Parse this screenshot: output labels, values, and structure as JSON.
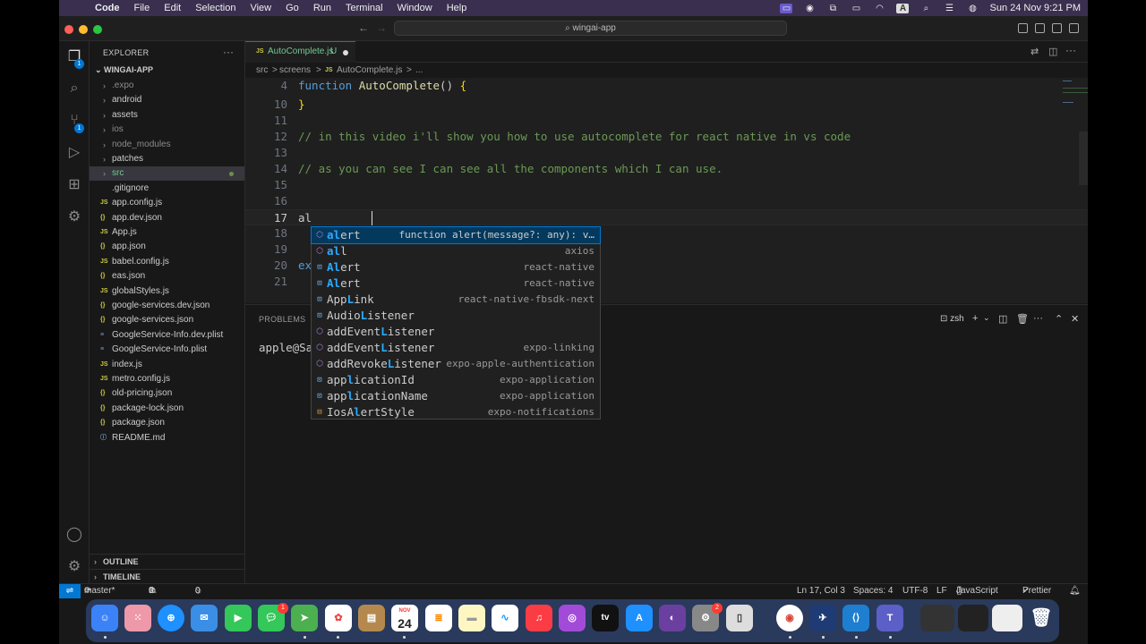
{
  "menubar": {
    "apple": "",
    "items": [
      "Code",
      "File",
      "Edit",
      "Selection",
      "View",
      "Go",
      "Run",
      "Terminal",
      "Window",
      "Help"
    ],
    "clock": "Sun 24 Nov  9:21 PM",
    "input_source": "A"
  },
  "titlebar": {
    "search": "wingai-app"
  },
  "activity": {
    "explorer_badge": "1",
    "scm_badge": "1"
  },
  "sidebar": {
    "header": "EXPLORER",
    "more": "···",
    "root": "WINGAI-APP",
    "items": [
      {
        "label": ".expo",
        "kind": "folder",
        "color": "#8b8b8b"
      },
      {
        "label": "android",
        "kind": "folder",
        "color": "#cccccc"
      },
      {
        "label": "assets",
        "kind": "folder",
        "color": "#cccccc"
      },
      {
        "label": "ios",
        "kind": "folder",
        "color": "#8b8b8b"
      },
      {
        "label": "node_modules",
        "kind": "folder",
        "color": "#8b8b8b"
      },
      {
        "label": "patches",
        "kind": "folder",
        "color": "#cccccc"
      },
      {
        "label": "src",
        "kind": "folder",
        "color": "#73c991"
      },
      {
        "label": ".gitignore",
        "kind": "file",
        "icon": "",
        "color": "#cccccc"
      },
      {
        "label": "app.config.js",
        "kind": "file",
        "icon": "JS",
        "color": "#cccccc"
      },
      {
        "label": "app.dev.json",
        "kind": "file",
        "icon": "{}",
        "color": "#cccccc"
      },
      {
        "label": "App.js",
        "kind": "file",
        "icon": "JS",
        "color": "#cccccc"
      },
      {
        "label": "app.json",
        "kind": "file",
        "icon": "{}",
        "color": "#cccccc"
      },
      {
        "label": "babel.config.js",
        "kind": "file",
        "icon": "JS",
        "color": "#cccccc"
      },
      {
        "label": "eas.json",
        "kind": "file",
        "icon": "{}",
        "color": "#cccccc"
      },
      {
        "label": "globalStyles.js",
        "kind": "file",
        "icon": "JS",
        "color": "#cccccc"
      },
      {
        "label": "google-services.dev.json",
        "kind": "file",
        "icon": "{}",
        "color": "#cccccc"
      },
      {
        "label": "google-services.json",
        "kind": "file",
        "icon": "{}",
        "color": "#cccccc"
      },
      {
        "label": "GoogleService-Info.dev.plist",
        "kind": "file",
        "icon": "≡",
        "color": "#cccccc"
      },
      {
        "label": "GoogleService-Info.plist",
        "kind": "file",
        "icon": "≡",
        "color": "#cccccc"
      },
      {
        "label": "index.js",
        "kind": "file",
        "icon": "JS",
        "color": "#cccccc"
      },
      {
        "label": "metro.config.js",
        "kind": "file",
        "icon": "JS",
        "color": "#cccccc"
      },
      {
        "label": "old-pricing.json",
        "kind": "file",
        "icon": "{}",
        "color": "#cccccc"
      },
      {
        "label": "package-lock.json",
        "kind": "file",
        "icon": "{}",
        "color": "#cccccc"
      },
      {
        "label": "package.json",
        "kind": "file",
        "icon": "{}",
        "color": "#cccccc"
      },
      {
        "label": "README.md",
        "kind": "file",
        "icon": "ⓘ",
        "color": "#cccccc"
      }
    ],
    "outline": "OUTLINE",
    "timeline": "TIMELINE"
  },
  "editor": {
    "tab": {
      "icon": "JS",
      "name": "AutoComplete.js",
      "status": "U"
    },
    "breadcrumb": [
      "src",
      ">",
      "screens",
      ">",
      "JS",
      "AutoComplete.js",
      ">",
      "..."
    ],
    "lines": [
      {
        "num": "4",
        "parts": [
          [
            "kw",
            "function "
          ],
          [
            "fn",
            "AutoComplete"
          ],
          [
            "id",
            "() "
          ],
          [
            "br",
            "{"
          ]
        ]
      },
      {
        "num": "10",
        "parts": [
          [
            "br",
            "}"
          ]
        ]
      },
      {
        "num": "11",
        "parts": []
      },
      {
        "num": "12",
        "parts": [
          [
            "cm",
            "// in this video i'll show you how to use autocomplete for react native in vs code"
          ]
        ]
      },
      {
        "num": "13",
        "parts": []
      },
      {
        "num": "14",
        "parts": [
          [
            "cm",
            "// as you can see I can see all the components which I can use."
          ]
        ]
      },
      {
        "num": "15",
        "parts": []
      },
      {
        "num": "16",
        "parts": []
      },
      {
        "num": "17",
        "parts": [
          [
            "id",
            "al"
          ]
        ]
      },
      {
        "num": "18",
        "parts": []
      },
      {
        "num": "19",
        "parts": []
      },
      {
        "num": "20",
        "parts": [
          [
            "kw",
            "ex"
          ]
        ]
      },
      {
        "num": "21",
        "parts": []
      }
    ],
    "current_line": "17"
  },
  "suggest": {
    "items": [
      {
        "icon": "fn",
        "pre": "",
        "match": "al",
        "post": "ert",
        "detail": "function alert(message?: any): v…"
      },
      {
        "icon": "fn",
        "pre": "",
        "match": "al",
        "post": "l",
        "detail": "axios"
      },
      {
        "icon": "var",
        "pre": "",
        "match": "Al",
        "post": "ert",
        "detail": "react-native"
      },
      {
        "icon": "var",
        "pre": "",
        "match": "Al",
        "post": "ert",
        "detail": "react-native"
      },
      {
        "icon": "var",
        "pre": "",
        "match": "A",
        "post": "ppLink",
        "detail": "react-native-fbsdk-next",
        "mid": {
          "pre": "App",
          "match": "L",
          "post": "ink"
        }
      },
      {
        "icon": "var",
        "pre": "",
        "match": "",
        "post": "",
        "full": {
          "pre": "Audio",
          "match": "L",
          "post": "istener",
          "first": "A"
        },
        "detail": ""
      },
      {
        "icon": "fn",
        "full": {
          "pre": "addEvent",
          "match": "L",
          "post": "istener",
          "first": "a"
        },
        "detail": ""
      },
      {
        "icon": "fn",
        "full": {
          "pre": "addEvent",
          "match": "L",
          "post": "istener",
          "first": "a"
        },
        "detail": "expo-linking"
      },
      {
        "icon": "fn",
        "full": {
          "pre": "addRevoke",
          "match": "L",
          "post": "istener",
          "first": "a"
        },
        "detail": "expo-apple-authentication"
      },
      {
        "icon": "var",
        "full": {
          "pre": "app",
          "match": "l",
          "post": "icationId",
          "first": "a"
        },
        "detail": "expo-application"
      },
      {
        "icon": "var",
        "full": {
          "pre": "app",
          "match": "l",
          "post": "icationName",
          "first": "a"
        },
        "detail": "expo-application"
      },
      {
        "icon": "enum",
        "full": {
          "pre": "IosA",
          "match": "l",
          "post": "ertStyle",
          "first": ""
        },
        "detail": "expo-notifications"
      }
    ]
  },
  "panel": {
    "tab": "PROBLEMS",
    "terminal_text": "apple@Sa",
    "shell": "zsh"
  },
  "statusbar": {
    "branch": "master*",
    "errors": "0",
    "warnings": "0",
    "ports": "0",
    "position": "Ln 17, Col 3",
    "spaces": "Spaces: 4",
    "encoding": "UTF-8",
    "eol": "LF",
    "language": "JavaScript",
    "formatter": "Prettier"
  },
  "dock": {
    "calendar_month": "NOV",
    "calendar_day": "24",
    "facetime_badge": "1",
    "chrome_badge": "2",
    "tv_label": "tv"
  },
  "colors": {
    "accent": "#0078d4",
    "untracked": "#73c991"
  }
}
